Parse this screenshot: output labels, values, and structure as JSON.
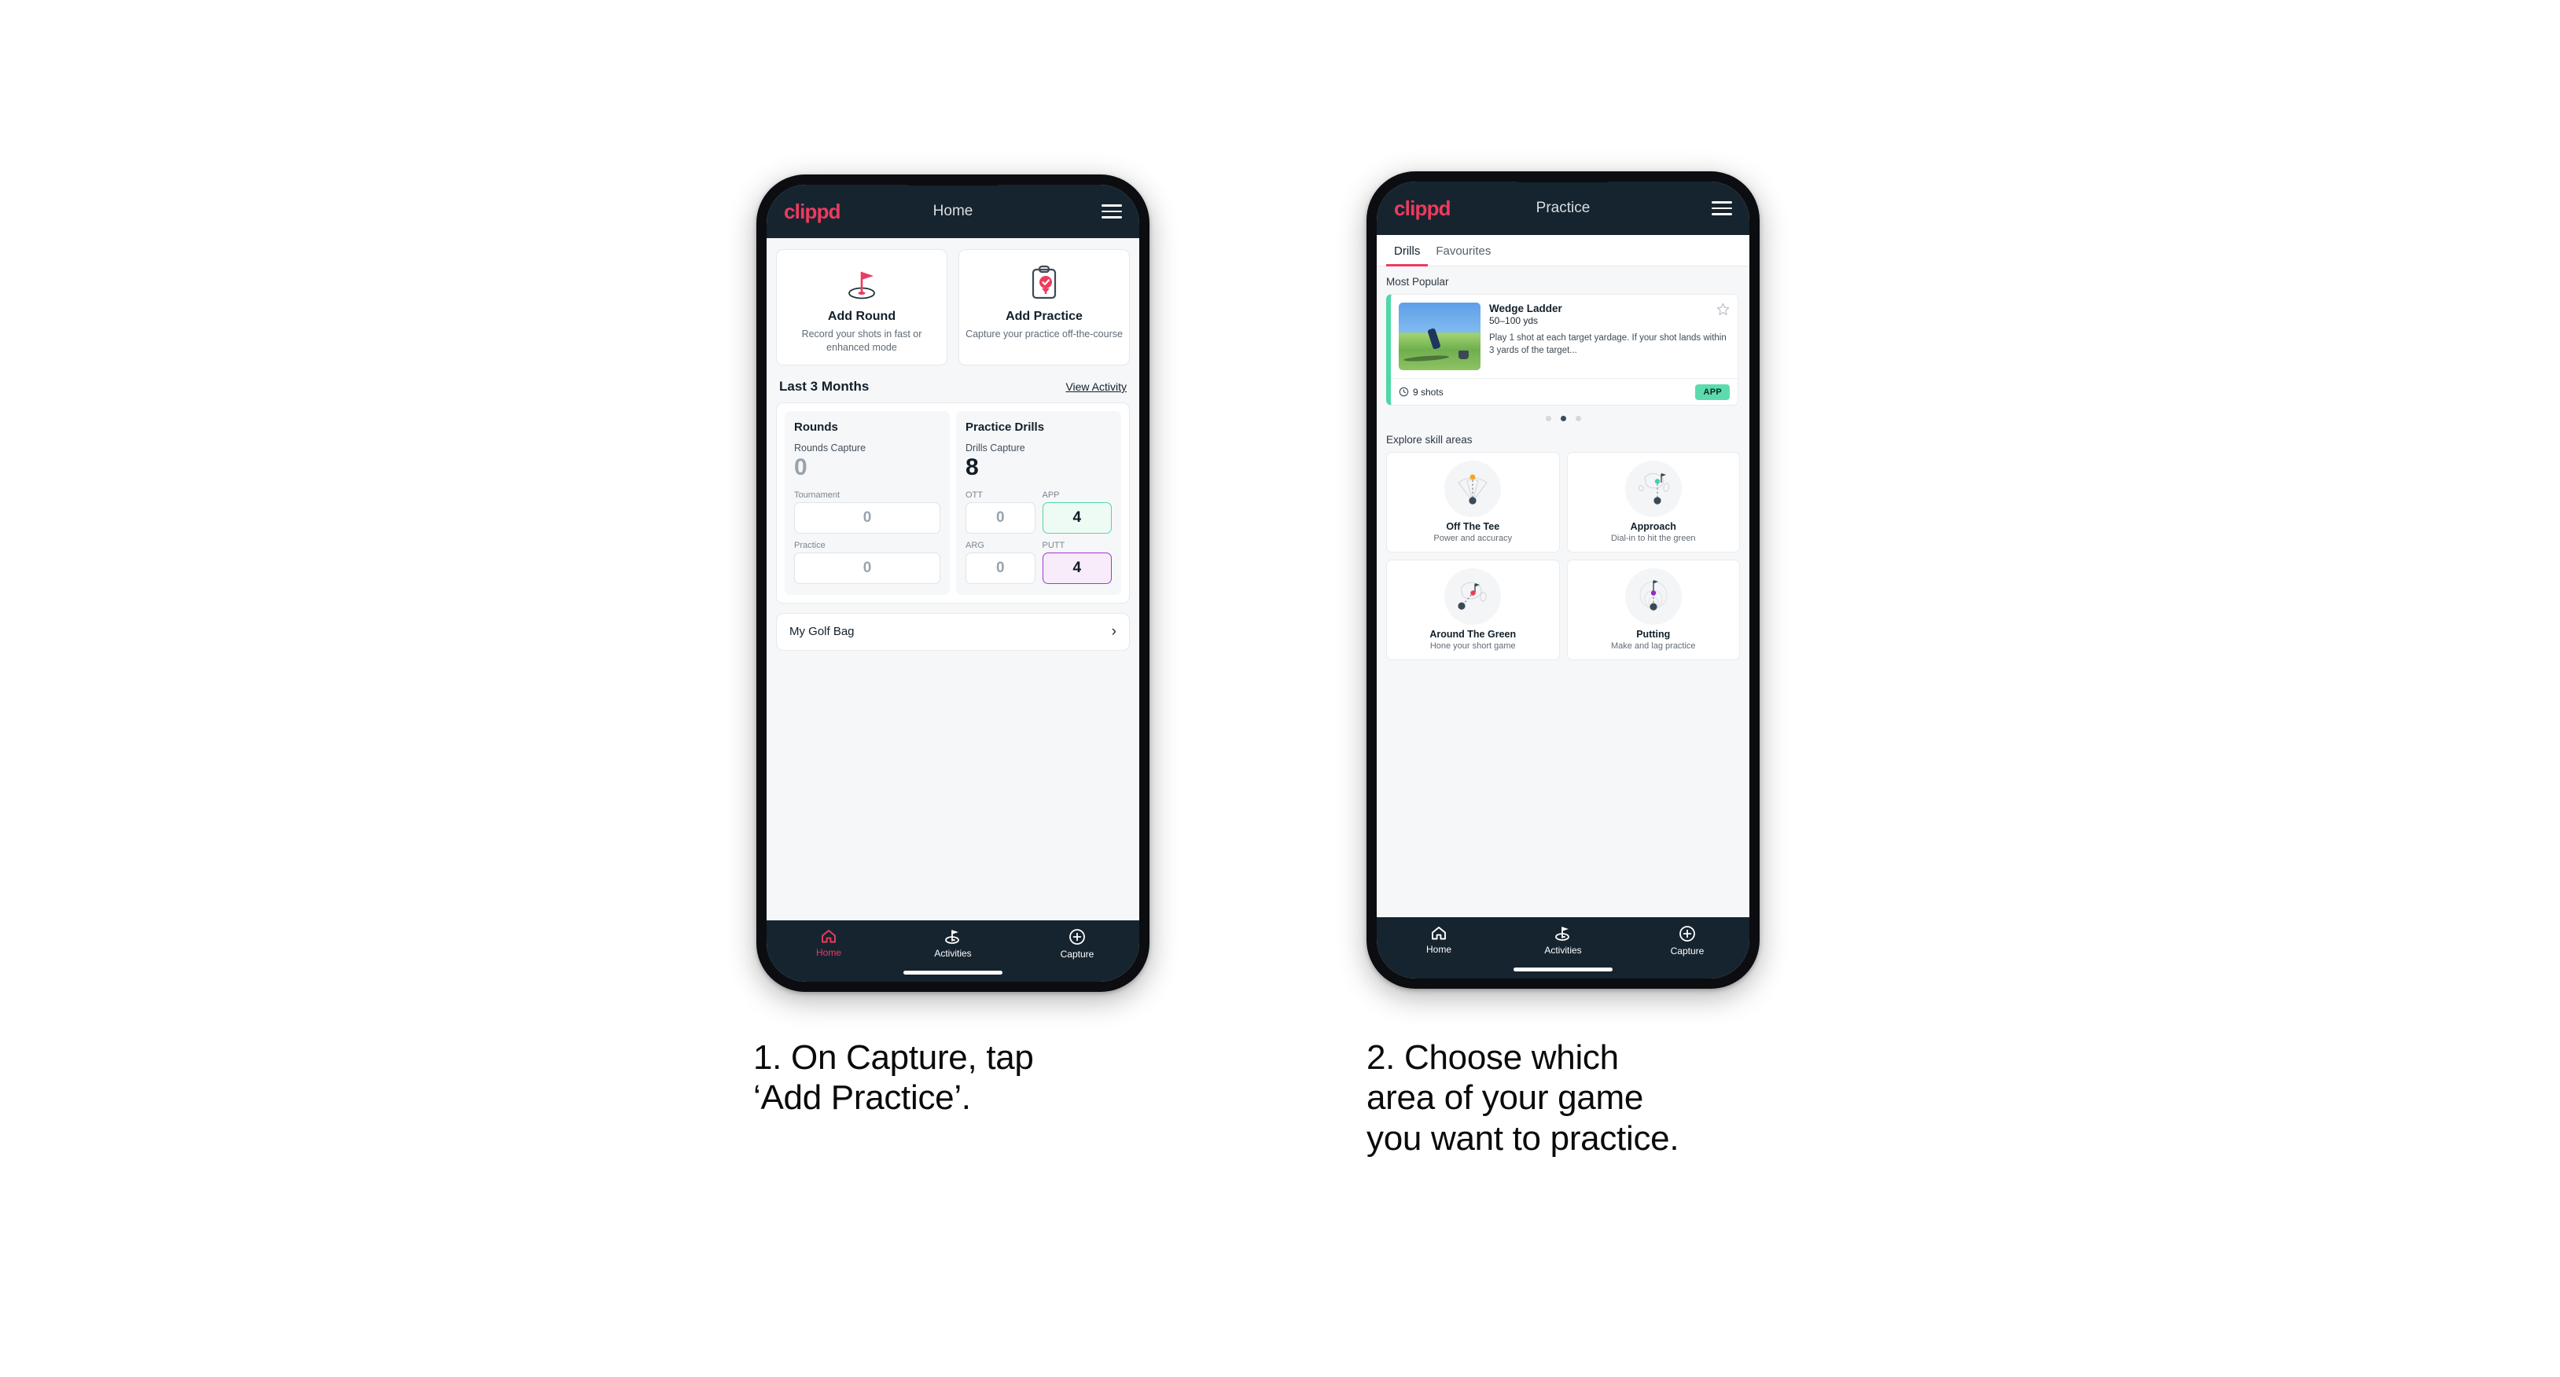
{
  "phone1": {
    "appbar": {
      "brand": "clippd",
      "title": "Home",
      "menu_icon": "hamburger-icon"
    },
    "quick_actions": [
      {
        "icon": "golf-flag-hole-icon",
        "title": "Add Round",
        "subtitle": "Record your shots in fast or enhanced mode"
      },
      {
        "icon": "clipboard-check-tee-icon",
        "title": "Add Practice",
        "subtitle": "Capture your practice off-the-course"
      }
    ],
    "section": {
      "title": "Last 3 Months",
      "link": "View Activity"
    },
    "rounds": {
      "heading": "Rounds",
      "capture_label": "Rounds Capture",
      "capture_value": "0",
      "items": [
        {
          "label": "Tournament",
          "value": "0",
          "highlight": "none"
        },
        {
          "label": "Practice",
          "value": "0",
          "highlight": "none"
        }
      ]
    },
    "drills": {
      "heading": "Practice Drills",
      "capture_label": "Drills Capture",
      "capture_value": "8",
      "items": [
        {
          "label": "OTT",
          "value": "0",
          "highlight": "none"
        },
        {
          "label": "APP",
          "value": "4",
          "highlight": "green"
        },
        {
          "label": "ARG",
          "value": "0",
          "highlight": "none"
        },
        {
          "label": "PUTT",
          "value": "4",
          "highlight": "purple"
        }
      ]
    },
    "golf_bag": {
      "label": "My Golf Bag",
      "chevron_icon": "chevron-right-icon"
    },
    "bottom_nav": [
      {
        "label": "Home",
        "icon": "home-icon",
        "state": "active-pink"
      },
      {
        "label": "Activities",
        "icon": "golf-flag-icon",
        "state": "active"
      },
      {
        "label": "Capture",
        "icon": "plus-circle-icon",
        "state": "default"
      }
    ]
  },
  "phone2": {
    "appbar": {
      "brand": "clippd",
      "title": "Practice",
      "menu_icon": "hamburger-icon"
    },
    "tabs": [
      {
        "label": "Drills",
        "active": true
      },
      {
        "label": "Favourites",
        "active": false
      }
    ],
    "most_popular_label": "Most Popular",
    "drill_card": {
      "title": "Wedge Ladder",
      "range": "50–100 yds",
      "description": "Play 1 shot at each target yardage. If your shot lands within 3 yards of the target...",
      "shots": "9 shots",
      "shots_icon": "clock-icon",
      "badge": "APP",
      "badge_color": "#5cdcae",
      "accent_color": "#4fd7a8",
      "next_accent_color": "#a833d6",
      "favourite_icon": "star-outline-icon",
      "thumbnail_alt": "golfer-hitting-wedge-photo"
    },
    "carousel_dots": {
      "count": 3,
      "active_index": 1
    },
    "skill_heading": "Explore skill areas",
    "skill_areas": [
      {
        "title": "Off The Tee",
        "subtitle": "Power and accuracy",
        "icon": "tee-shot-dispersion-icon",
        "accent": "#f5a623"
      },
      {
        "title": "Approach",
        "subtitle": "Dial-in to hit the green",
        "icon": "approach-green-icon",
        "accent": "#3fd0b0"
      },
      {
        "title": "Around The Green",
        "subtitle": "Hone your short game",
        "icon": "chip-around-green-icon",
        "accent": "#ec3b5e"
      },
      {
        "title": "Putting",
        "subtitle": "Make and lag practice",
        "icon": "putting-rings-icon",
        "accent": "#9b26c4"
      }
    ],
    "bottom_nav": [
      {
        "label": "Home",
        "icon": "home-icon",
        "state": "default"
      },
      {
        "label": "Activities",
        "icon": "golf-flag-icon",
        "state": "active"
      },
      {
        "label": "Capture",
        "icon": "plus-circle-icon",
        "state": "default"
      }
    ]
  },
  "captions": {
    "step1": "1. On Capture, tap\n‘Add Practice’.",
    "step2": "2. Choose which\narea of your game\nyou want to practice."
  }
}
